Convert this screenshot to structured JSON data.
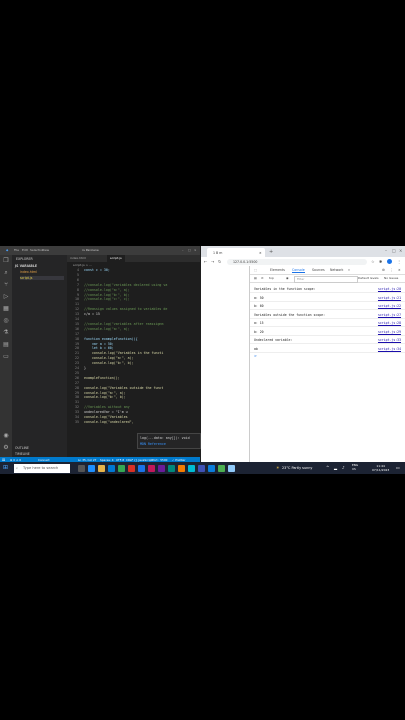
{
  "vscode": {
    "title": "rs Parolene",
    "menu": [
      "File",
      "Edit",
      "Selection",
      "View",
      "Go",
      "Run"
    ],
    "explorer": {
      "header": "EXPLORER",
      "section": "JS VARIABLE",
      "items": [
        "index.html",
        "script.js"
      ],
      "outline": "OUTLINE",
      "timeline": "TIMELINE"
    },
    "tabs": [
      "index.html",
      "script.js"
    ],
    "breadcrumb": "script.js > ...",
    "code_lines": [
      {
        "n": "4",
        "t": "const c = 30;"
      },
      {
        "n": "5",
        "t": ""
      },
      {
        "n": "6",
        "t": ""
      },
      {
        "n": "7",
        "t": "//console.log(\"variables declared using va"
      },
      {
        "n": "8",
        "t": "//console.log(\"a:\", a);"
      },
      {
        "n": "9",
        "t": "//console.log(\"b:\", b);"
      },
      {
        "n": "10",
        "t": "//console.log(\"c:\", c);"
      },
      {
        "n": "11",
        "t": ""
      },
      {
        "n": "12",
        "t": "//Reassign values assigned to variables de"
      },
      {
        "n": "13",
        "t": "c/a = 15"
      },
      {
        "n": "14",
        "t": ""
      },
      {
        "n": "15",
        "t": "//console.log(\"variables after reassignm"
      },
      {
        "n": "16",
        "t": "//console.log(\"a:\", a);"
      },
      {
        "n": "17",
        "t": ""
      },
      {
        "n": "18",
        "t": "function exampleFunction(){"
      },
      {
        "n": "19",
        "t": "    var a = 50;"
      },
      {
        "n": "20",
        "t": "    let b = 60;"
      },
      {
        "n": "21",
        "t": "    console.log(\"Variables in the functi"
      },
      {
        "n": "22",
        "t": "    console.log(\"a:\", a);"
      },
      {
        "n": "23",
        "t": "    console.log(\"b:\", b);"
      },
      {
        "n": "24",
        "t": "}"
      },
      {
        "n": "25",
        "t": ""
      },
      {
        "n": "26",
        "t": "exampleFunction();"
      },
      {
        "n": "27",
        "t": ""
      },
      {
        "n": "28",
        "t": "console.log(\"Variables outside the funct"
      },
      {
        "n": "29",
        "t": "console.log(\"a:\", a);"
      },
      {
        "n": "30",
        "t": "console.log(\"b:\", b);"
      },
      {
        "n": "31",
        "t": ""
      },
      {
        "n": "32",
        "t": "//Variables without any"
      },
      {
        "n": "33",
        "t": "undeclaredVar = \"I'm u"
      },
      {
        "n": "34",
        "t": "console.log(\"Variables"
      },
      {
        "n": "35",
        "t": "console.log(\"undeclared\","
      }
    ],
    "tooltip": {
      "line1": "log(...data: any[]): void",
      "line2": "MDN Reference"
    },
    "statusbar": {
      "left": "⊗ 0 ⚠ 0",
      "connect": "Connect",
      "position": "Ln 35, Col 27",
      "spaces": "Spaces: 4",
      "encoding": "UTF-8",
      "eol": "CRLF",
      "lang": "{} JavaScript",
      "port": "Port : 5500",
      "prettier": "✓ Prettier"
    }
  },
  "chrome": {
    "tab_title": "1 B m",
    "url": "127.0.0.1:5500",
    "devtools_tabs": [
      "Elements",
      "Console",
      "Sources",
      "Network",
      "»"
    ],
    "active_tab": "Console",
    "toolbar": {
      "context": "top",
      "filter": "Filter",
      "levels": "Default levels",
      "issues": "No Issues"
    },
    "console": [
      {
        "msg": "Variables in the function scope:",
        "src": "script.js:20"
      },
      {
        "msg": "a: 50",
        "src": "script.js:21"
      },
      {
        "msg": "b: 60",
        "src": "script.js:22"
      },
      {
        "msg": "Variables outside the function scope:",
        "src": "script.js:27"
      },
      {
        "msg": "a: 15",
        "src": "script.js:28"
      },
      {
        "msg": "b: 20",
        "src": "script.js:29"
      },
      {
        "msg": "Undeclared variable:",
        "src": "script.js:33"
      },
      {
        "msg": "ab",
        "src": "script.js:34"
      }
    ],
    "prompt": ">"
  },
  "taskbar": {
    "search_placeholder": "Type here to search",
    "weather": "23°C  Partly sunny",
    "lang": "ENG\nUS",
    "time": "11:44",
    "date": "07/11/2023"
  },
  "colors": {
    "accent": "#007acc",
    "devtools_link": "#1a0dab",
    "comment": "#6a9955"
  }
}
